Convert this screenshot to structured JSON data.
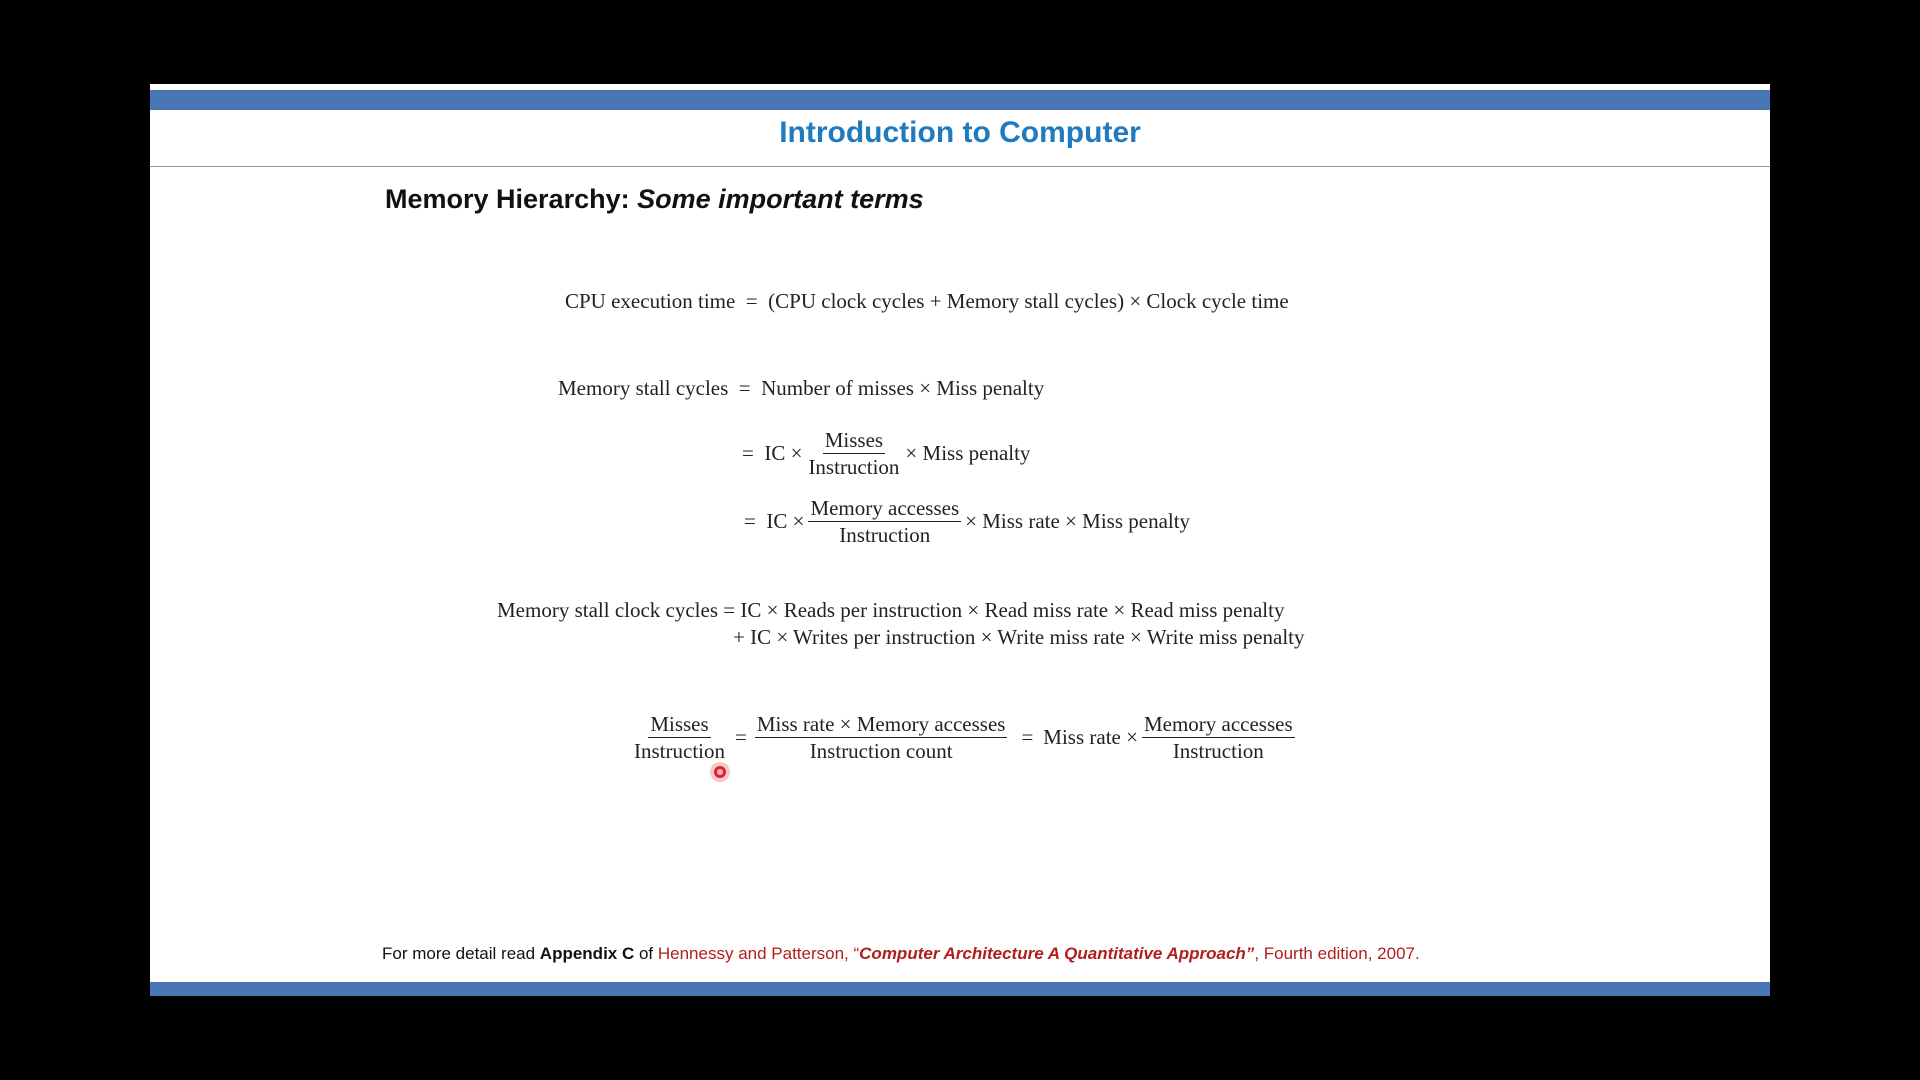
{
  "slide": {
    "title": "Introduction to Computer",
    "subtitle_main": "Memory Hierarchy: ",
    "subtitle_emph": "Some important terms"
  },
  "equations": {
    "eq1": "CPU execution time  =  (CPU clock cycles + Memory stall cycles) × Clock cycle time",
    "eq2": {
      "lhs": "Memory stall cycles  =  Number of misses × Miss penalty",
      "line2_pre": "=  IC ×",
      "line2_num": "Misses",
      "line2_den": "Instruction",
      "line2_post": "× Miss penalty",
      "line3_pre": "=  IC ×",
      "line3_num": "Memory accesses",
      "line3_den": "Instruction",
      "line3_post": "× Miss rate × Miss penalty"
    },
    "eq3": {
      "line1": "Memory stall clock cycles = IC × Reads per instruction × Read miss rate × Read miss penalty",
      "line2": "+ IC × Writes per instruction × Write miss rate × Write miss penalty"
    },
    "eq4": {
      "f1_num": "Misses",
      "f1_den": "Instruction",
      "eq_a": "=",
      "f2_num": "Miss rate × Memory accesses",
      "f2_den": "Instruction count",
      "eq_b": "=",
      "mid": "Miss rate ×",
      "f3_num": "Memory accesses",
      "f3_den": "Instruction"
    }
  },
  "footer": {
    "t1": "For more detail read ",
    "t2": "Appendix C",
    "t3": " of ",
    "t4": "Hennessy and Patterson, “",
    "t5": "Computer Architecture A Quantitative Approach”",
    "t6": ", Fourth edition, 2007."
  },
  "colors": {
    "title": "#1f7bbf",
    "bars": "#4a76b3",
    "reference": "#b01e1e",
    "cursor": "#e31f2a"
  }
}
